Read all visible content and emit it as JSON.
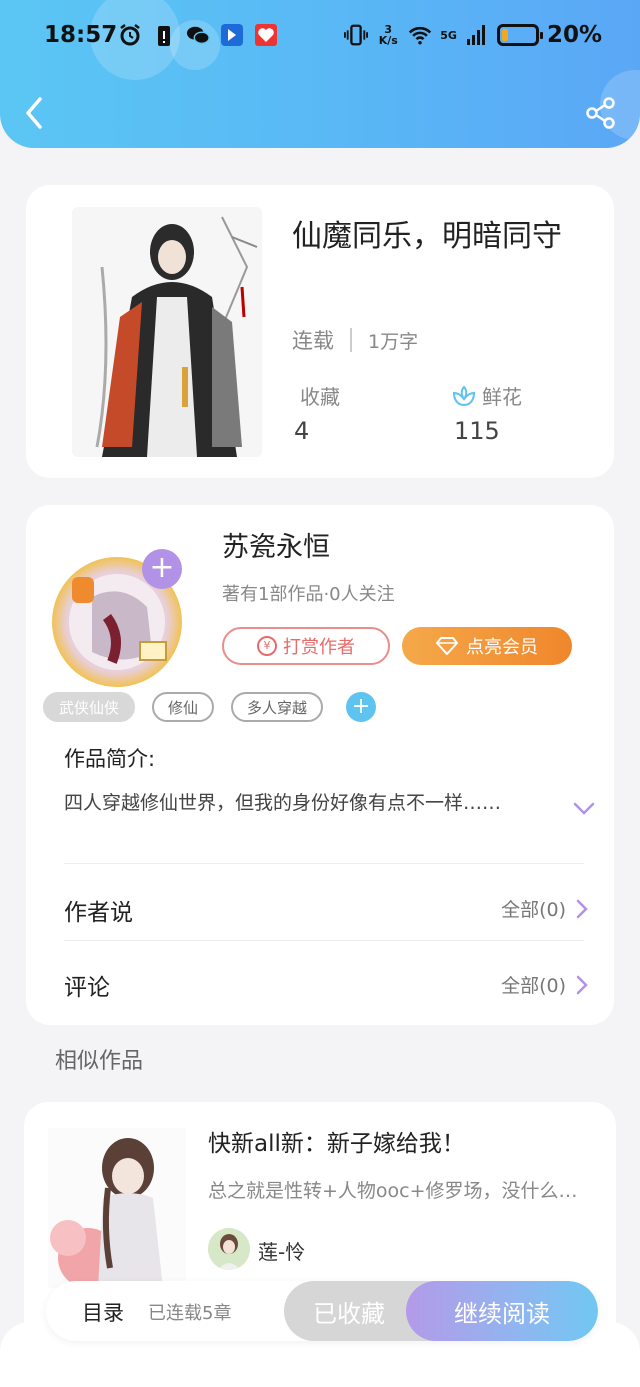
{
  "status_bar": {
    "time": "18:57",
    "net_speed_top": "3",
    "net_speed_unit": "K/s",
    "signal": "5G",
    "battery": "20%",
    "battery_fraction": 0.2
  },
  "book": {
    "title": "仙魔同乐，明暗同守",
    "status": "连载",
    "words": "1万字",
    "favorites_label": "收藏",
    "favorites_value": "4",
    "flowers_label": "鲜花",
    "flowers_value": "115"
  },
  "author": {
    "name": "苏瓷永恒",
    "meta": "著有1部作品·0人关注",
    "tip_button": "打赏作者",
    "tip_icon_glyph": "¥",
    "vip_button": "点亮会员"
  },
  "tags": [
    "武侠仙侠",
    "修仙",
    "多人穿越"
  ],
  "intro": {
    "title": "作品简介:",
    "text": "四人穿越修仙世界，但我的身份好像有点不一样……"
  },
  "rows": {
    "author_says": "作者说",
    "author_says_link": "全部(0)",
    "comments": "评论",
    "comments_link": "全部(0)"
  },
  "similar": {
    "section_title": "相似作品",
    "title": "快新all新：新子嫁给我！",
    "desc": "总之就是性转+人物ooc+修罗场，没什么…",
    "author": "莲-怜"
  },
  "bottom": {
    "toc": "目录",
    "toc_sub": "已连载5章",
    "collected": "已收藏",
    "read": "继续阅读"
  }
}
